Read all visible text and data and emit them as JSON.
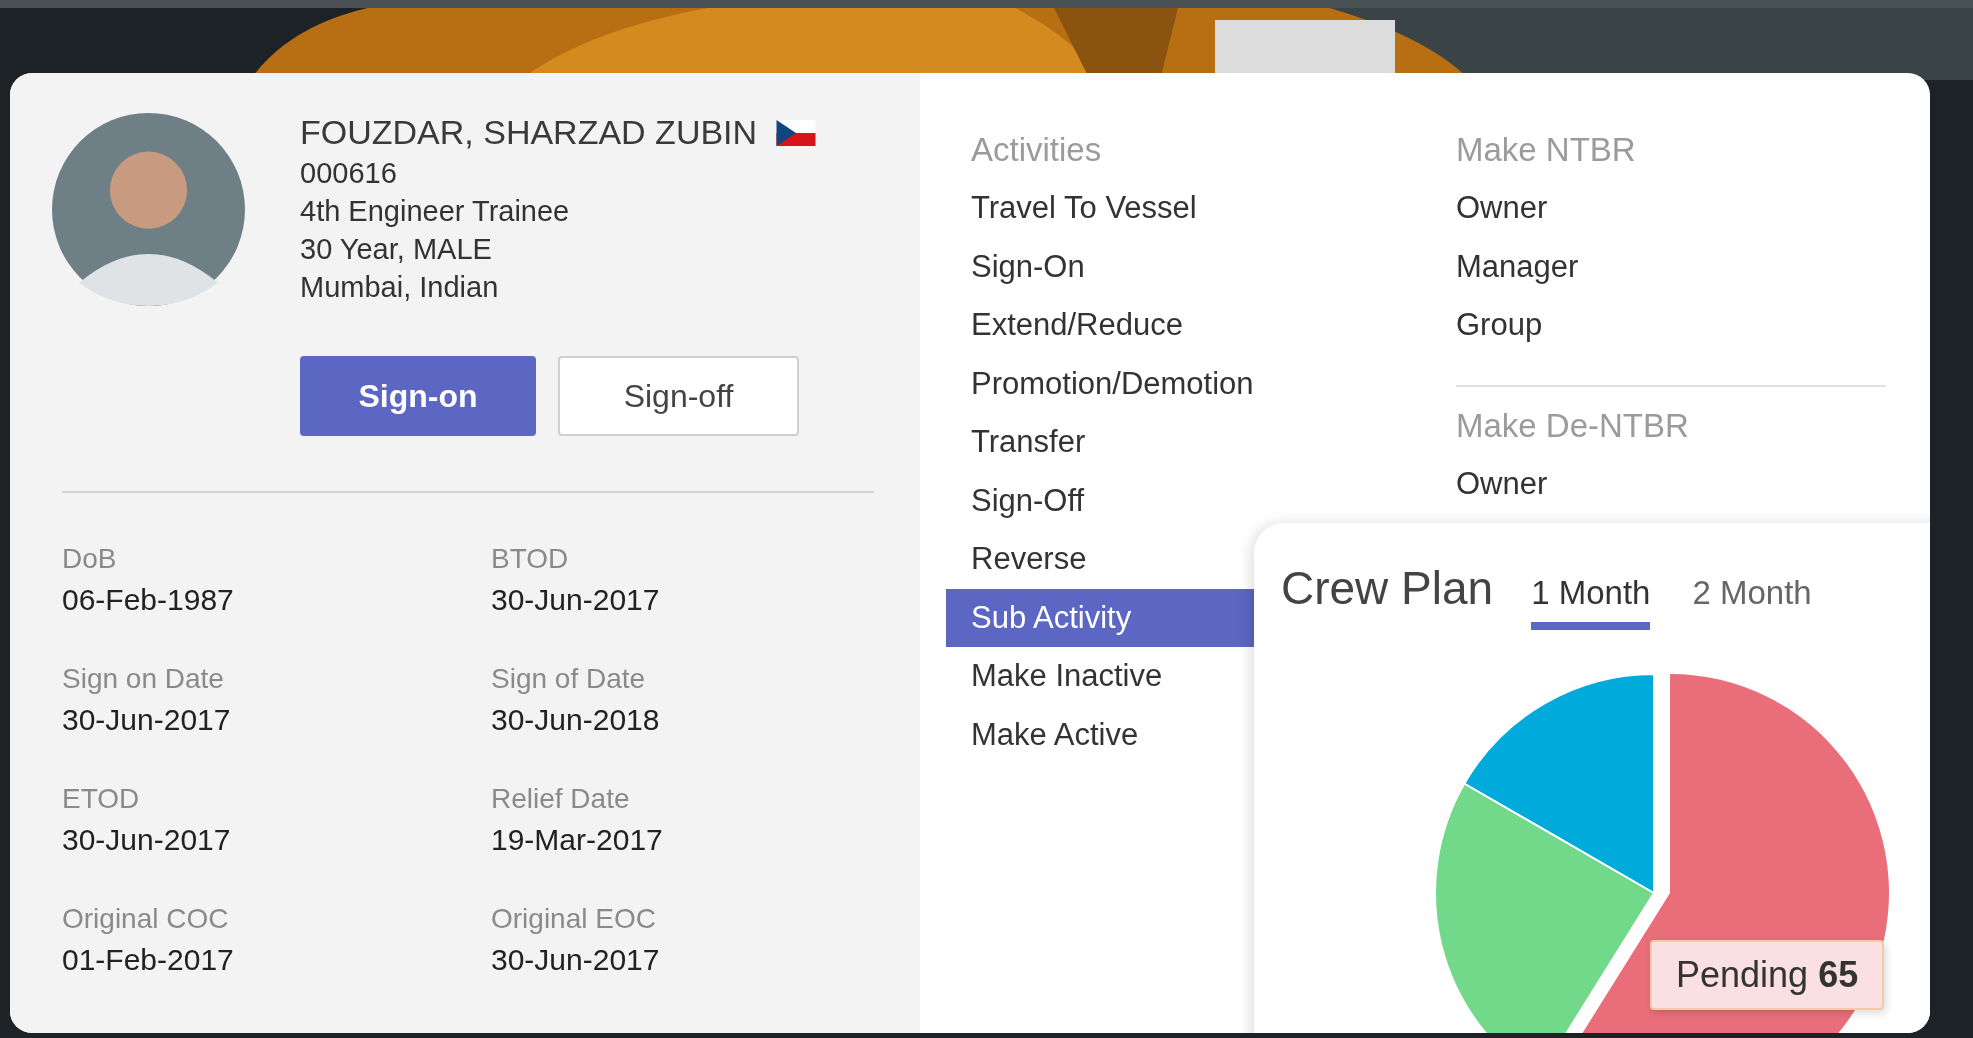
{
  "profile": {
    "name": "FOUZDAR, SHARZAD ZUBIN",
    "code": "000616",
    "rank": "4th Engineer Trainee",
    "age_gender": "30 Year, MALE",
    "location": "Mumbai, Indian"
  },
  "buttons": [
    {
      "label": "Sign-on",
      "kind": "primary"
    },
    {
      "label": "Sign-off",
      "kind": "secondary"
    }
  ],
  "details": [
    {
      "label": "DoB",
      "value": "06-Feb-1987"
    },
    {
      "label": "BTOD",
      "value": "30-Jun-2017"
    },
    {
      "label": "Sign on Date",
      "value": "30-Jun-2017"
    },
    {
      "label": "Sign of Date",
      "value": "30-Jun-2018"
    },
    {
      "label": "ETOD",
      "value": "30-Jun-2017"
    },
    {
      "label": "Relief Date",
      "value": "19-Mar-2017"
    },
    {
      "label": "Original COC",
      "value": "01-Feb-2017"
    },
    {
      "label": "Original EOC",
      "value": "30-Jun-2017"
    }
  ],
  "activities": {
    "heading": "Activities",
    "items": [
      {
        "label": "Travel To Vessel",
        "selected": false
      },
      {
        "label": "Sign-On",
        "selected": false
      },
      {
        "label": "Extend/Reduce",
        "selected": false
      },
      {
        "label": "Promotion/Demotion",
        "selected": false
      },
      {
        "label": "Transfer",
        "selected": false
      },
      {
        "label": "Sign-Off",
        "selected": false
      },
      {
        "label": "Reverse",
        "selected": false
      },
      {
        "label": "Sub Activity",
        "selected": true
      },
      {
        "label": "Make Inactive",
        "selected": false
      },
      {
        "label": "Make Active",
        "selected": false
      }
    ]
  },
  "ntbr_groups": [
    {
      "heading": "Make NTBR",
      "items": [
        "Owner",
        "Manager",
        "Group"
      ]
    },
    {
      "heading": "Make De-NTBR",
      "items": [
        "Owner"
      ]
    }
  ],
  "crew_plan": {
    "title": "Crew Plan",
    "tabs": [
      {
        "label": "1 Month",
        "selected": true
      },
      {
        "label": "2 Month",
        "selected": false
      }
    ],
    "tooltip": {
      "label": "Pending",
      "value": "65"
    }
  }
}
